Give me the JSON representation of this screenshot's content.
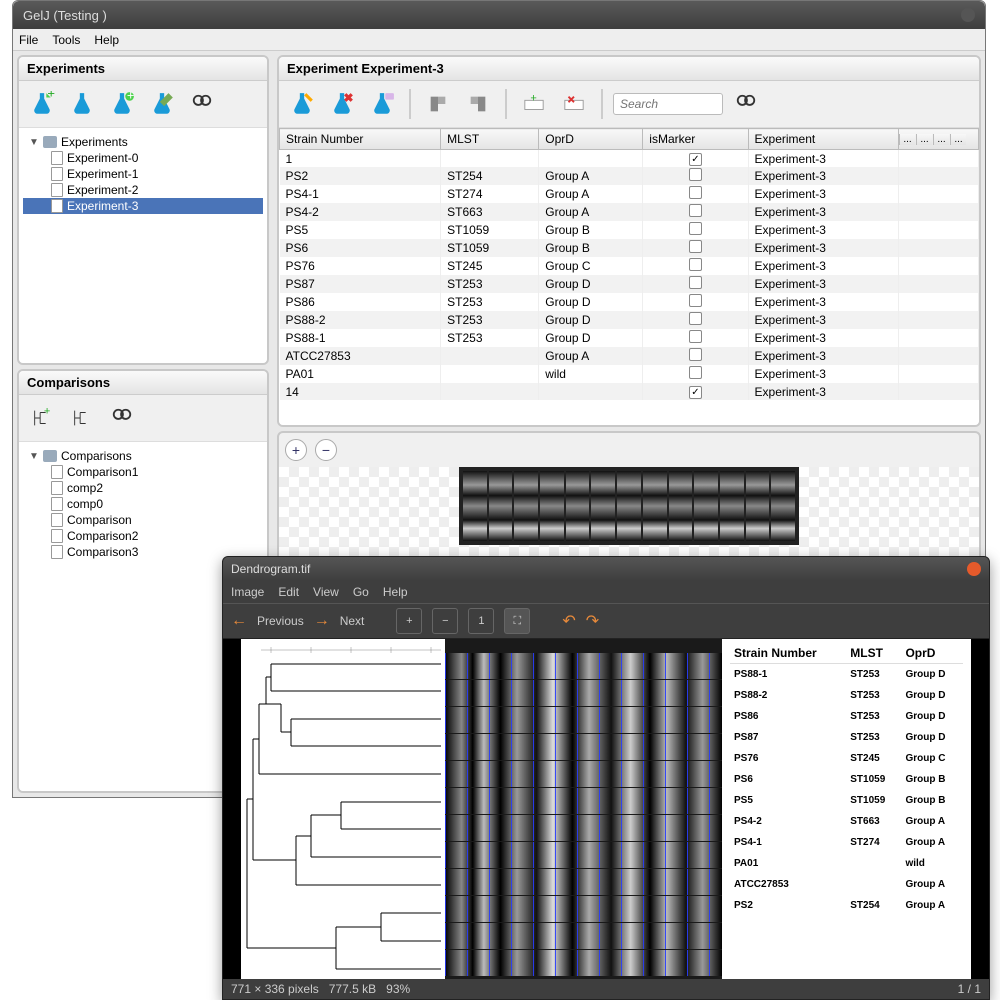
{
  "app": {
    "title": "GelJ (Testing )",
    "menu": [
      "File",
      "Tools",
      "Help"
    ]
  },
  "panels": {
    "experiments": "Experiments",
    "comparisons": "Comparisons",
    "experiment_detail": "Experiment Experiment-3"
  },
  "tree": {
    "experiments_root": "Experiments",
    "experiments": [
      "Experiment-0",
      "Experiment-1",
      "Experiment-2",
      "Experiment-3"
    ],
    "experiments_selected": 3,
    "comparisons_root": "Comparisons",
    "comparisons": [
      "Comparison1",
      "comp2",
      "comp0",
      "Comparison",
      "Comparison2",
      "Comparison3"
    ]
  },
  "search": {
    "placeholder": "Search"
  },
  "table": {
    "columns": [
      "Strain Number",
      "MLST",
      "OprD",
      "isMarker",
      "Experiment"
    ],
    "extra_cols": [
      "...",
      "...",
      "...",
      "..."
    ],
    "rows": [
      {
        "strain": "1",
        "mlst": "",
        "oprd": "",
        "marker": true,
        "exp": "Experiment-3"
      },
      {
        "strain": "PS2",
        "mlst": "ST254",
        "oprd": "Group A",
        "marker": false,
        "exp": "Experiment-3"
      },
      {
        "strain": "PS4-1",
        "mlst": "ST274",
        "oprd": "Group A",
        "marker": false,
        "exp": "Experiment-3"
      },
      {
        "strain": "PS4-2",
        "mlst": "ST663",
        "oprd": "Group A",
        "marker": false,
        "exp": "Experiment-3"
      },
      {
        "strain": "PS5",
        "mlst": "ST1059",
        "oprd": "Group B",
        "marker": false,
        "exp": "Experiment-3"
      },
      {
        "strain": "PS6",
        "mlst": "ST1059",
        "oprd": "Group B",
        "marker": false,
        "exp": "Experiment-3"
      },
      {
        "strain": "PS76",
        "mlst": "ST245",
        "oprd": "Group C",
        "marker": false,
        "exp": "Experiment-3"
      },
      {
        "strain": "PS87",
        "mlst": "ST253",
        "oprd": "Group D",
        "marker": false,
        "exp": "Experiment-3"
      },
      {
        "strain": "PS86",
        "mlst": "ST253",
        "oprd": "Group D",
        "marker": false,
        "exp": "Experiment-3"
      },
      {
        "strain": "PS88-2",
        "mlst": "ST253",
        "oprd": "Group D",
        "marker": false,
        "exp": "Experiment-3"
      },
      {
        "strain": "PS88-1",
        "mlst": "ST253",
        "oprd": "Group D",
        "marker": false,
        "exp": "Experiment-3"
      },
      {
        "strain": "ATCC27853",
        "mlst": "",
        "oprd": "Group A",
        "marker": false,
        "exp": "Experiment-3"
      },
      {
        "strain": "PA01",
        "mlst": "",
        "oprd": "wild",
        "marker": false,
        "exp": "Experiment-3"
      },
      {
        "strain": "14",
        "mlst": "",
        "oprd": "",
        "marker": true,
        "exp": "Experiment-3"
      }
    ]
  },
  "viewer": {
    "title": "Dendrogram.tif",
    "menu": [
      "Image",
      "Edit",
      "View",
      "Go",
      "Help"
    ],
    "nav": {
      "prev": "Previous",
      "next": "Next"
    },
    "status": {
      "dims": "771 × 336 pixels",
      "size": "777.5 kB",
      "zoom": "93%",
      "page": "1 / 1"
    },
    "columns": [
      "Strain Number",
      "MLST",
      "OprD"
    ],
    "rows": [
      {
        "strain": "PS88-1",
        "mlst": "ST253",
        "oprd": "Group D"
      },
      {
        "strain": "PS88-2",
        "mlst": "ST253",
        "oprd": "Group D"
      },
      {
        "strain": "PS86",
        "mlst": "ST253",
        "oprd": "Group D"
      },
      {
        "strain": "PS87",
        "mlst": "ST253",
        "oprd": "Group D"
      },
      {
        "strain": "PS76",
        "mlst": "ST245",
        "oprd": "Group C"
      },
      {
        "strain": "PS6",
        "mlst": "ST1059",
        "oprd": "Group B"
      },
      {
        "strain": "PS5",
        "mlst": "ST1059",
        "oprd": "Group B"
      },
      {
        "strain": "PS4-2",
        "mlst": "ST663",
        "oprd": "Group A"
      },
      {
        "strain": "PS4-1",
        "mlst": "ST274",
        "oprd": "Group A"
      },
      {
        "strain": "PA01",
        "mlst": "",
        "oprd": "wild"
      },
      {
        "strain": "ATCC27853",
        "mlst": "",
        "oprd": "Group A"
      },
      {
        "strain": "PS2",
        "mlst": "ST254",
        "oprd": "Group A"
      }
    ]
  }
}
